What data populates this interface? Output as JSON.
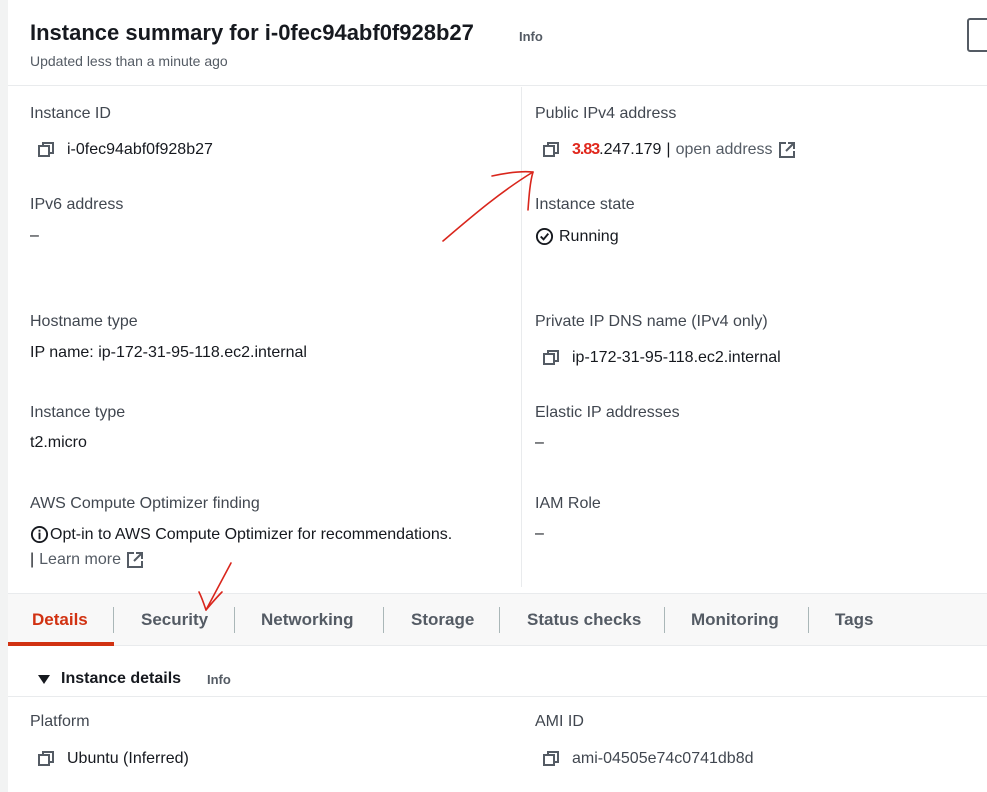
{
  "header": {
    "title": "Instance summary for i-0fec94abf0f928b27",
    "info_label": "Info",
    "updated_text": "Updated less than a minute ago"
  },
  "summary": {
    "instance_id": {
      "label": "Instance ID",
      "value": "i-0fec94abf0f928b27"
    },
    "public_ipv4": {
      "label": "Public IPv4 address",
      "redacted_part": "3.83",
      "value_suffix": ".247.179",
      "separator": "|",
      "open_link": "open address"
    },
    "ipv6": {
      "label": "IPv6 address",
      "value": "–"
    },
    "instance_state": {
      "label": "Instance state",
      "value": "Running"
    },
    "hostname_type": {
      "label": "Hostname type",
      "value": "IP name: ip-172-31-95-118.ec2.internal"
    },
    "private_dns": {
      "label": "Private IP DNS name (IPv4 only)",
      "value": "ip-172-31-95-118.ec2.internal"
    },
    "instance_type": {
      "label": "Instance type",
      "value": "t2.micro"
    },
    "elastic_ip": {
      "label": "Elastic IP addresses",
      "value": "–"
    },
    "optimizer": {
      "label": "AWS Compute Optimizer finding",
      "text": "Opt-in to AWS Compute Optimizer for recommendations.",
      "separator": "|",
      "learn_more": "Learn more"
    },
    "iam_role": {
      "label": "IAM Role",
      "value": "–"
    }
  },
  "tabs": [
    {
      "label": "Details",
      "active": true
    },
    {
      "label": "Security",
      "active": false
    },
    {
      "label": "Networking",
      "active": false
    },
    {
      "label": "Storage",
      "active": false
    },
    {
      "label": "Status checks",
      "active": false
    },
    {
      "label": "Monitoring",
      "active": false
    },
    {
      "label": "Tags",
      "active": false
    }
  ],
  "instance_details": {
    "title": "Instance details",
    "info_label": "Info",
    "platform": {
      "label": "Platform",
      "value": "Ubuntu (Inferred)"
    },
    "ami_id": {
      "label": "AMI ID",
      "value": "ami-04505e74c0741db8d"
    }
  },
  "icons": {
    "copy": "copy-icon",
    "external_link": "external-link-icon",
    "status_ok": "status-check-icon",
    "info": "info-circle-icon",
    "caret": "caret-down-icon"
  },
  "colors": {
    "active_tab": "#d13212",
    "link": "#545b64",
    "annotation_red": "#d9261c"
  }
}
